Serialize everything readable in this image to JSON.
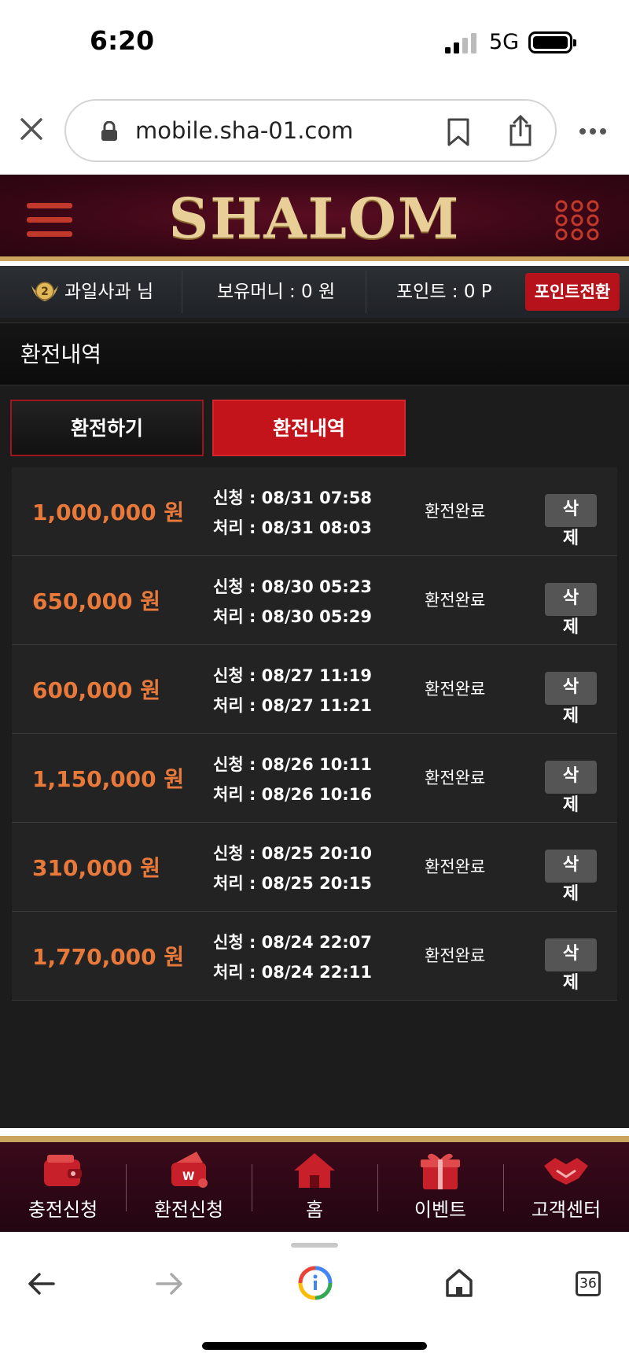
{
  "status_bar": {
    "time": "6:20",
    "network": "5G"
  },
  "browser": {
    "url": "mobile.sha-01.com",
    "tab_count": "36"
  },
  "site": {
    "logo": "SHALOM",
    "user": {
      "level": "2",
      "name": "과일사과 님",
      "balance": "보유머니 : 0 원",
      "points": "포인트 : 0 P",
      "convert_button": "포인트전환"
    }
  },
  "page": {
    "title": "환전내역",
    "tabs": [
      {
        "label": "환전하기"
      },
      {
        "label": "환전내역"
      }
    ],
    "rows": [
      {
        "amount": "1,000,000 원",
        "requested": "신청 : 08/31 07:58",
        "processed": "처리 : 08/31 08:03",
        "status": "환전완료",
        "delete_1": "삭",
        "delete_2": "제"
      },
      {
        "amount": "650,000 원",
        "requested": "신청 : 08/30 05:23",
        "processed": "처리 : 08/30 05:29",
        "status": "환전완료",
        "delete_1": "삭",
        "delete_2": "제"
      },
      {
        "amount": "600,000 원",
        "requested": "신청 : 08/27 11:19",
        "processed": "처리 : 08/27 11:21",
        "status": "환전완료",
        "delete_1": "삭",
        "delete_2": "제"
      },
      {
        "amount": "1,150,000 원",
        "requested": "신청 : 08/26 10:11",
        "processed": "처리 : 08/26 10:16",
        "status": "환전완료",
        "delete_1": "삭",
        "delete_2": "제"
      },
      {
        "amount": "310,000 원",
        "requested": "신청 : 08/25 20:10",
        "processed": "처리 : 08/25 20:15",
        "status": "환전완료",
        "delete_1": "삭",
        "delete_2": "제"
      },
      {
        "amount": "1,770,000 원",
        "requested": "신청 : 08/24 22:07",
        "processed": "처리 : 08/24 22:11",
        "status": "환전완료",
        "delete_1": "삭",
        "delete_2": "제"
      }
    ]
  },
  "bottom_nav": [
    {
      "label": "충전신청",
      "icon": "wallet-icon"
    },
    {
      "label": "환전신청",
      "icon": "withdraw-wallet-icon"
    },
    {
      "label": "홈",
      "icon": "home-icon"
    },
    {
      "label": "이벤트",
      "icon": "gift-icon"
    },
    {
      "label": "고객센터",
      "icon": "handshake-icon"
    }
  ],
  "colors": {
    "accent_red": "#c3141c",
    "amount_orange": "#e8793a",
    "gold": "#c9a45c",
    "header_maroon": "#3a0716"
  }
}
